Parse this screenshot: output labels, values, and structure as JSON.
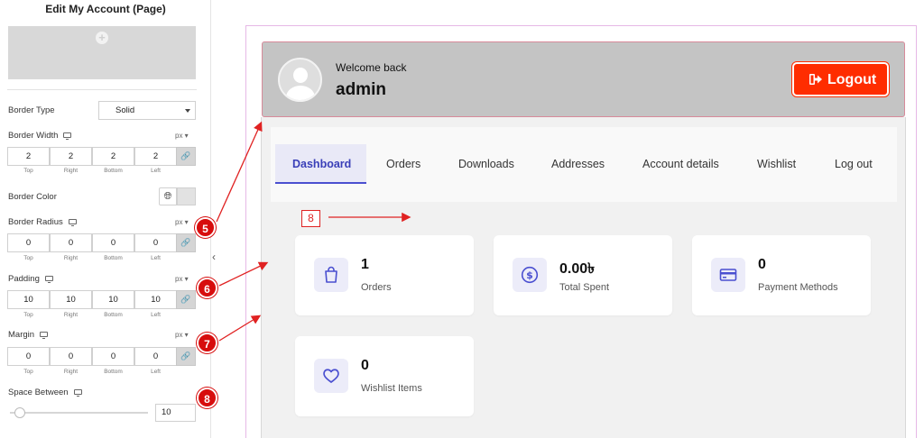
{
  "panel": {
    "title": "Edit My Account (Page)",
    "border_type": {
      "label": "Border Type",
      "value": "Solid"
    },
    "border_width": {
      "label": "Border Width",
      "unit": "px",
      "values": [
        "2",
        "2",
        "2",
        "2"
      ]
    },
    "border_color": {
      "label": "Border Color"
    },
    "border_radius": {
      "label": "Border Radius",
      "unit": "px",
      "values": [
        "0",
        "0",
        "0",
        "0"
      ]
    },
    "padding": {
      "label": "Padding",
      "unit": "px",
      "values": [
        "10",
        "10",
        "10",
        "10"
      ]
    },
    "margin": {
      "label": "Margin",
      "unit": "px",
      "values": [
        "0",
        "0",
        "0",
        "0"
      ]
    },
    "sides": [
      "Top",
      "Right",
      "Bottom",
      "Left"
    ],
    "space_between": {
      "label": "Space Between",
      "value": "10"
    }
  },
  "callouts": [
    "5",
    "6",
    "7",
    "8",
    "8"
  ],
  "account": {
    "welcome": "Welcome back",
    "username": "admin",
    "logout_label": "Logout",
    "tabs": [
      "Dashboard",
      "Orders",
      "Downloads",
      "Addresses",
      "Account details",
      "Wishlist",
      "Log out"
    ],
    "active_tab": "Dashboard",
    "cards": [
      {
        "value": "1",
        "label": "Orders",
        "icon": "shopping-bag-icon"
      },
      {
        "value": "0.00৳",
        "label": "Total Spent",
        "icon": "dollar-icon"
      },
      {
        "value": "0",
        "label": "Payment Methods",
        "icon": "credit-card-icon"
      },
      {
        "value": "0",
        "label": "Wishlist Items",
        "icon": "heart-icon"
      }
    ]
  },
  "colors": {
    "accent": "#4a4fd0",
    "logout": "#ff2d00",
    "callout": "#d70d0d",
    "header": "#c4c4c4"
  }
}
